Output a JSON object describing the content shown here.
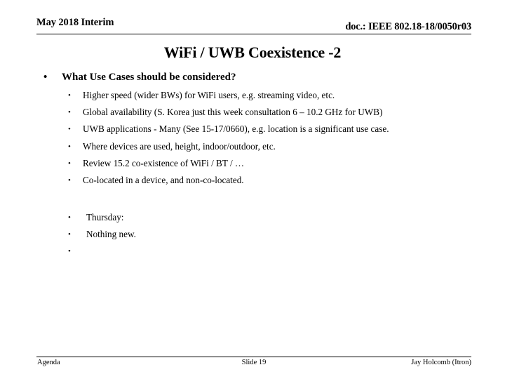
{
  "header": {
    "left": "May 2018 Interim",
    "right": "doc.: IEEE 802.18-18/0050r03"
  },
  "title": "WiFi / UWB Coexistence  -2",
  "bullet_glyph": "•",
  "content": {
    "level1": "What Use Cases should be considered?",
    "use_cases": [
      "Higher speed  (wider BWs) for WiFi users, e.g. streaming video, etc.",
      "Global availability (S. Korea just this week consultation 6 – 10.2 GHz for UWB)",
      "UWB applications -  Many (See 15-17/0660), e.g. location is a significant use case.",
      "Where devices are used, height, indoor/outdoor, etc.",
      "Review 15.2  co-existence of  WiFi / BT / …",
      "Co-located in a device, and non-co-located."
    ],
    "notes": [
      "Thursday:",
      "Nothing new.",
      ""
    ]
  },
  "footer": {
    "left": "Agenda",
    "center": "Slide 19",
    "right": "Jay Holcomb (Itron)"
  }
}
